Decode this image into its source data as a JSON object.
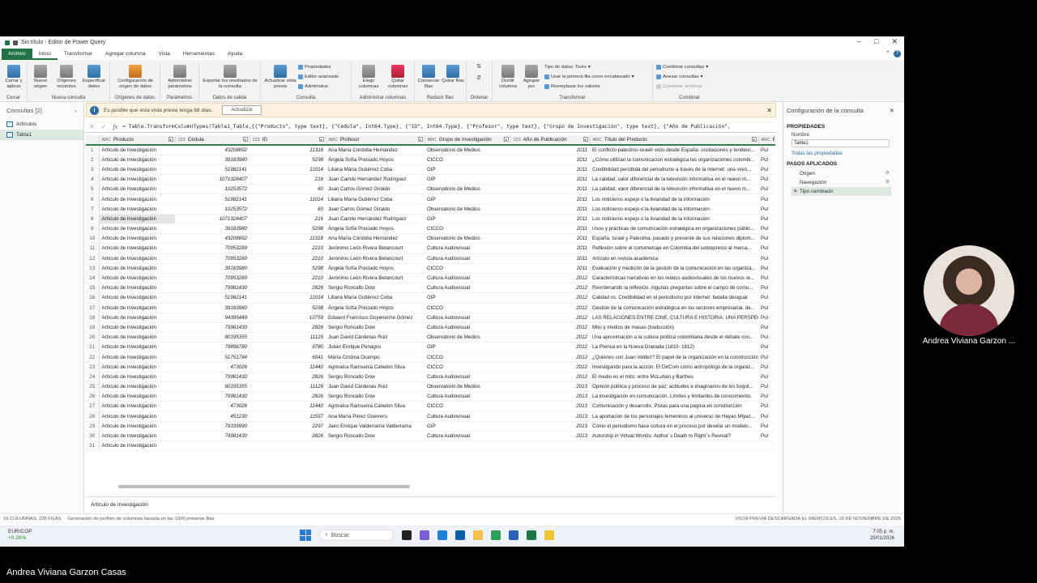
{
  "window": {
    "title": "Sin título - Editor de Power Query"
  },
  "menu": [
    "Archivo",
    "Inicio",
    "Transformar",
    "Agregar columna",
    "Vista",
    "Herramientas",
    "Ayuda"
  ],
  "ribbon": {
    "cerrar": {
      "btn": "Cerrar y aplicar",
      "group": "Cerrar"
    },
    "nueva": {
      "b1": "Nuevo origen",
      "b2": "Orígenes recientes",
      "b3": "Especificar datos",
      "group": "Nueva consulta"
    },
    "origenes": {
      "b1": "Configuración de origen de datos",
      "group": "Orígenes de datos"
    },
    "parametros": {
      "b1": "Administrar parámetros",
      "group": "Parámetros"
    },
    "salida": {
      "b1": "Exportar los resultados de la consulta",
      "group": "Datos de salida"
    },
    "consulta": {
      "b1": "Actualizar vista previa",
      "s1": "Propiedades",
      "s2": "Editor avanzado",
      "s3": "Administrar",
      "group": "Consulta"
    },
    "columnas": {
      "b1": "Elegir columnas",
      "b2": "Quitar columnas",
      "group": "Administrar columnas"
    },
    "filas": {
      "b1": "Conservar filas",
      "b2": "Quitar filas",
      "group": "Reducir filas"
    },
    "ordenar": {
      "group": "Ordenar"
    },
    "transformar": {
      "b1": "Dividir columna",
      "b2": "Agrupar por",
      "s1": "Tipo de datos: Texto",
      "s2": "Usar la primera fila como encabezado",
      "s3": "Reemplazar los valores",
      "group": "Transformar"
    },
    "combinar": {
      "s1": "Combinar consultas",
      "s2": "Anexar consultas",
      "s3": "Combinar archivos",
      "group": "Combinar"
    }
  },
  "queries": {
    "title": "Consultas [2]",
    "items": [
      "Artículos",
      "Tabla1"
    ]
  },
  "warning": {
    "text": "Es posible que esta vista previa tenga 68 días.",
    "button": "Actualizar"
  },
  "formula": "= Table.TransformColumnTypes(Tabla1_Table,{{\"Producto\", type text}, {\"Cédula\", Int64.Type}, {\"ID\", Int64.Type}, {\"Profesor\", type text}, {\"Grupo de Investigación\", type text}, {\"Año de Publicación\",",
  "columns": [
    {
      "type": "ABC",
      "name": "Producto"
    },
    {
      "type": "123",
      "name": "Cédula"
    },
    {
      "type": "123",
      "name": "ID"
    },
    {
      "type": "ABC",
      "name": "Profesor"
    },
    {
      "type": "ABC",
      "name": "Grupo de Investigación"
    },
    {
      "type": "123",
      "name": "Año de Publicación"
    },
    {
      "type": "ABC",
      "name": "Título del Producto"
    },
    {
      "type": "ABC",
      "name": "Es"
    }
  ],
  "rows": [
    [
      "Artículo de Investigación",
      "43208892",
      "11318",
      "Ana María Córdoba Hernández",
      "Observatorio de Medios",
      "2011",
      "El conflicto palestino-israelí visto desde España: oscilaciones y tendenc...",
      "Pul"
    ],
    [
      "Artículo de Investigación",
      "39183980",
      "5298",
      "Ángela Sofía Preciado Hoyos",
      "CICCO",
      "2011",
      "¿Cómo utilizan la comunicación estratégica las organizaciones colombi...",
      "Pul"
    ],
    [
      "Artículo de Investigación",
      "51982141",
      "11014",
      "Liliana María Gutiérrez Coba",
      "GIP",
      "2011",
      "Credibilidad percibida del periodismo a través de la Internet: una visió...",
      "Pul"
    ],
    [
      "Artículo de Investigación",
      "1071328407",
      "216",
      "Juan Camilo Hernández Rodríguez",
      "GIP",
      "2011",
      "La calidad, valor diferencial de la televisión informativa en el nuevo m...",
      "Pul"
    ],
    [
      "Artículo de Investigación",
      "10253572",
      "60",
      "Juan Carlos Gómez Giraldo",
      "Observatorio de Medios",
      "2011",
      "La calidad, valor diferencial de la televisión informativa en el nuevo m...",
      "Pul"
    ],
    [
      "Artículo de Investigación",
      "51982141",
      "11014",
      "Liliana María Gutiérrez Coba",
      "GIP",
      "2011",
      "Los noticieros espejo o la liviandad de la información",
      "Pul"
    ],
    [
      "Artículo de Investigación",
      "10253572",
      "60",
      "Juan Carlos Gómez Giraldo",
      "Observatorio de Medios",
      "2011",
      "Los noticieros espejo o la liviandad de la información",
      "Pul"
    ],
    [
      "Artículo de Investigación",
      "1071328407",
      "216",
      "Juan Camilo Hernández Rodríguez",
      "GIP",
      "2011",
      "Los noticieros espejo o la liviandad de la información",
      "Pul"
    ],
    [
      "Artículo de Investigación",
      "39183980",
      "5298",
      "Ángela Sofía Preciado Hoyos",
      "CICCO",
      "2011",
      "Usos y prácticas de comunicación estratégica en organizaciones públic...",
      "Pul"
    ],
    [
      "Artículo de Investigación",
      "43208892",
      "11318",
      "Ana María Córdoba Hernández",
      "Observatorio de Medios",
      "2011",
      "España, Israel y Palestina: pasado y presente de sus relaciones diplom...",
      "Pul"
    ],
    [
      "Artículo de Investigación",
      "70953289",
      "2210",
      "Jerónimo León Rivera Betancourt",
      "Cultura Audiovisual",
      "2011",
      "Reflexión sobre el cortometraje en Colombia del sobreprecio al merca...",
      "Pul"
    ],
    [
      "Artículo de Investigación",
      "70953289",
      "2210",
      "Jerónimo León Rivera Betancourt",
      "Cultura Audiovisual",
      "2011",
      "Artículo en revista académica",
      "Pul"
    ],
    [
      "Artículo de Investigación",
      "39183980",
      "5298",
      "Ángela Sofía Preciado Hoyos",
      "CICCO",
      "2011",
      "Evaluación y medición de la gestión de la comunicación en las organiza...",
      "Pul"
    ],
    [
      "Artículo de Investigación",
      "70953289",
      "2210",
      "Jerónimo León Rivera Betancourt",
      "Cultura Audiovisual",
      "2012",
      "Características narrativas en los relatos audiovisuales de los nuevos re...",
      "Pul"
    ],
    [
      "Artículo de Investigación",
      "79981430",
      "2826",
      "Sergio Roncallo Dow",
      "Cultura Audiovisual",
      "2012",
      "Reordenando la reflexión. Algunas preguntas sobre el campo de comu...",
      "Pul"
    ],
    [
      "Artículo de Investigación",
      "51982141",
      "11014",
      "Liliana María Gutiérrez Coba",
      "GIP",
      "2012",
      "Calidad vs. Credibilidad en el periodismo por internet: batalla desigual",
      "Pul"
    ],
    [
      "Artículo de Investigación",
      "39183980",
      "5298",
      "Ángela Sofía Preciado Hoyos",
      "CICCO",
      "2012",
      "Gestión de la comunicación estratégica en los sectores empresarial, de...",
      "Pul"
    ],
    [
      "Artículo de Investigación",
      "94395449",
      "10759",
      "Edward Francisco Goyeneche Gómez",
      "Cultura Audiovisual",
      "2012",
      "LAS RELACIONES ENTRE CINE, CULTURA E HISTORIA: UNA PERSPECTIV...",
      "Pul"
    ],
    [
      "Artículo de Investigación",
      "79981430",
      "2826",
      "Sergio Roncallo Dow",
      "Cultura Audiovisual",
      "2012",
      "Mito y medios de masas (traducción)",
      "Pul"
    ],
    [
      "Artículo de Investigación",
      "80195355",
      "11129",
      "Juan David Cárdenas Ruiz",
      "Observatorio de Medios",
      "2012",
      "Una aproximación a la cultura política colombiana desde el debate con...",
      "Pul"
    ],
    [
      "Artículo de Investigación",
      "79896780",
      "9780",
      "Julián Enrique Penagos",
      "GIP",
      "2012",
      "La Prensa en la Nueva Granada (1810- 1812)",
      "Pul"
    ],
    [
      "Artículo de Investigación",
      "51751784",
      "6041",
      "María Cristina Ocampo",
      "CICCO",
      "2012",
      "¿Quiénes son Juan Valdez? El papel de la organización en la construcción ...",
      "Pul"
    ],
    [
      "Artículo de Investigación",
      "473026",
      "11440",
      "Agrivalca Ramsenia Canelon Silva",
      "CICCO",
      "2012",
      "Investigando para la acción: El DirCom como antropólogo de la organiz...",
      "Pul"
    ],
    [
      "Artículo de Investigación",
      "79981430",
      "2826",
      "Sergio Roncallo Dow",
      "Cultura Audiovisual",
      "2012",
      "El medio es el mito: entre McLuhan y Barthes",
      "Pul"
    ],
    [
      "Artículo de Investigación",
      "80195355",
      "11129",
      "Juan David Cárdenas Ruiz",
      "Observatorio de Medios",
      "2013",
      "Opinión pública y proceso de paz: actitudes e imaginarios de los bogot...",
      "Pul"
    ],
    [
      "Artículo de Investigación",
      "79981430",
      "2826",
      "Sergio Roncallo Dow",
      "Cultura Audiovisual",
      "2013",
      "La investigación en comunicación. Límites y limitantes de conocimiento.",
      "Pul"
    ],
    [
      "Artículo de Investigación",
      "473026",
      "11440",
      "Agrivalca Ramsenia Canelon Silva",
      "CICCO",
      "2013",
      "Comunicación y desarrollo. Pistas para una página en construcción",
      "Pul"
    ],
    [
      "Artículo de Investigación",
      "451230",
      "11597",
      "Ana María Pérez Guerrero",
      "Cultura Audiovisual",
      "2013",
      "La aportación de los personajes femeninos al universo de Hayao Miyaz...",
      "Pul"
    ],
    [
      "Artículo de Investigación",
      "79339990",
      "2297",
      "Jairo Enrique Valderrama Valderrama",
      "GIP",
      "2013",
      "Cómo el periodismo hace cultura en el proceso por develar un modelo...",
      "Pul"
    ],
    [
      "Artículo de Investigación",
      "79981430",
      "2826",
      "Sergio Roncallo Dow",
      "Cultura Audiovisual",
      "2013",
      "Autorship in Virtual Worlds: Author´s Death to Right´s Revival?",
      "Pul"
    ],
    [
      "Artículo de Investigación",
      "",
      "",
      "",
      "",
      "",
      "",
      ""
    ]
  ],
  "selected_row_index": 8,
  "preview_value": "Artículo de Investigación",
  "settings": {
    "title": "Configuración de la consulta",
    "props_header": "PROPIEDADES",
    "name_label": "Nombre",
    "name_value": "Tabla1",
    "all_props": "Todas las propiedades",
    "steps_header": "PASOS APLICADOS",
    "steps": [
      "Origen",
      "Navegación",
      "Tipo cambiado"
    ]
  },
  "status": {
    "left": "16 COLUMNAS, 235 FILAS",
    "middle": "Generación de perfiles de columnas basada en las 1000 primeras filas",
    "right": "VISTA PREVIA DESCARGADA EL MIÉRCOLES, 19 DE NOVIEMBRE DE 2025"
  },
  "taskbar": {
    "ticker": "EUR/COP",
    "change": "+0.26%",
    "search": "Buscar",
    "time": "7:05 p. m.",
    "date": "25/01/2026"
  },
  "participant": {
    "cam_name": "Andrea Viviana Garzon ...",
    "full_name": "Andrea Viviana Garzon Casas"
  }
}
